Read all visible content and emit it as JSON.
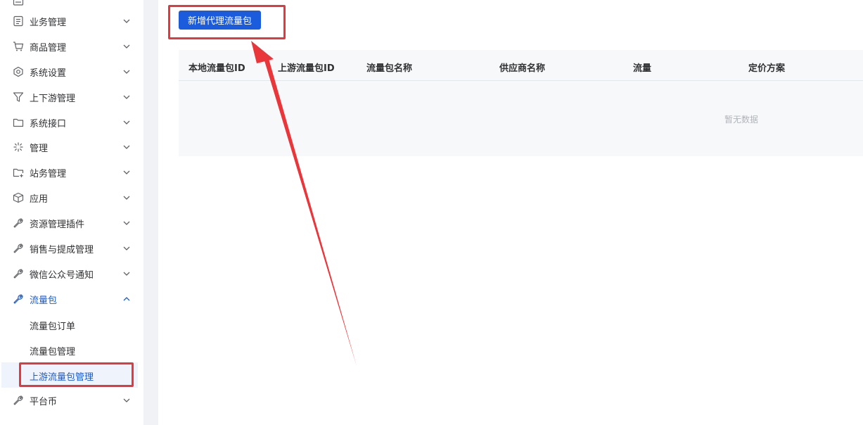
{
  "sidebar": {
    "items": [
      {
        "label": "业务管理",
        "icon": "document-icon"
      },
      {
        "label": "商品管理",
        "icon": "cart-icon"
      },
      {
        "label": "系统设置",
        "icon": "settings-icon"
      },
      {
        "label": "上下游管理",
        "icon": "filter-icon"
      },
      {
        "label": "系统接口",
        "icon": "folder-icon"
      },
      {
        "label": "管理",
        "icon": "sparkle-icon"
      },
      {
        "label": "站务管理",
        "icon": "folder-add-icon"
      },
      {
        "label": "应用",
        "icon": "box-icon"
      },
      {
        "label": "资源管理插件",
        "icon": "wrench-icon"
      },
      {
        "label": "销售与提成管理",
        "icon": "wrench-icon"
      },
      {
        "label": "微信公众号通知",
        "icon": "wrench-icon"
      },
      {
        "label": "流量包",
        "icon": "wrench-icon",
        "expanded": true
      },
      {
        "label": "平台币",
        "icon": "wrench-icon"
      }
    ],
    "submenu": [
      {
        "label": "流量包订单"
      },
      {
        "label": "流量包管理"
      },
      {
        "label": "上游流量包管理",
        "selected": true
      }
    ]
  },
  "main": {
    "add_button": "新增代理流量包",
    "table": {
      "columns": [
        "本地流量包ID",
        "上游流量包ID",
        "流量包名称",
        "供应商名称",
        "流量",
        "定价方案"
      ],
      "empty_text": "暂无数据"
    }
  },
  "colors": {
    "accent": "#1a5cdc",
    "active_text": "#1a5ccc",
    "annotation": "#e8363a"
  }
}
